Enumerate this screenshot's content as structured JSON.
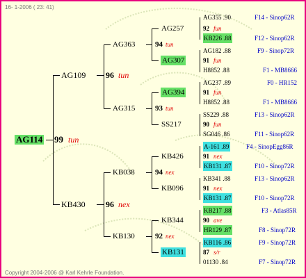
{
  "header": {
    "date_text": "16- 1-2006 ( 23: 41)"
  },
  "footer": {
    "copyright": "Copyright 2004-2006 @ Karl Kehrle Foundation."
  },
  "colors": {
    "border": "#e8007f",
    "background": "#ffffe1",
    "highlight_green": "#66e066",
    "highlight_cyan": "#3fe0e0",
    "score": "#000000",
    "quality_red": "#e00000",
    "ref_blue": "#0000c8"
  },
  "root": {
    "name": "AG114",
    "score": "99",
    "quality": "tun"
  },
  "gen1": [
    {
      "name": "AG109",
      "score": "96",
      "quality": "tun"
    },
    {
      "name": "KB430",
      "score": "96",
      "quality": "nex"
    }
  ],
  "gen2": [
    {
      "name": "AG363",
      "score": "94",
      "quality": "tun"
    },
    {
      "name": "AG315",
      "score": "93",
      "quality": "tun"
    },
    {
      "name": "KB038",
      "score": "94",
      "quality": "nex"
    },
    {
      "name": "KB130",
      "score": "92",
      "quality": "nex"
    }
  ],
  "gen3": [
    {
      "name": "AG257"
    },
    {
      "name": "AG307"
    },
    {
      "name": "AG394"
    },
    {
      "name": "SS217"
    },
    {
      "name": "KB426"
    },
    {
      "name": "KB096"
    },
    {
      "name": "KB344"
    },
    {
      "name": "KB131"
    }
  ],
  "gen4": [
    {
      "name": "AG355 .90",
      "score": "",
      "quality": "",
      "ref": "F14 - Sinop62R"
    },
    {
      "name": "",
      "score": "92",
      "quality": "fun",
      "ref": ""
    },
    {
      "name": "KB226 .88",
      "score": "",
      "quality": "",
      "ref": "F12 - Sinop62R"
    },
    {
      "name": "AG182 .88",
      "score": "",
      "quality": "",
      "ref": "F9 - Sinop72R"
    },
    {
      "name": "",
      "score": "91",
      "quality": "fun",
      "ref": ""
    },
    {
      "name": "H8852 .88",
      "score": "",
      "quality": "",
      "ref": "F1 - MB8666"
    },
    {
      "name": "AG237 .89",
      "score": "",
      "quality": "",
      "ref": "F0 - HR152"
    },
    {
      "name": "",
      "score": "91",
      "quality": "fun",
      "ref": ""
    },
    {
      "name": "H8852 .88",
      "score": "",
      "quality": "",
      "ref": "F1 - MB8666"
    },
    {
      "name": "SS229 .88",
      "score": "",
      "quality": "",
      "ref": "F13 - Sinop62R"
    },
    {
      "name": "",
      "score": "90",
      "quality": "fun",
      "ref": ""
    },
    {
      "name": "SG046 .86",
      "score": "",
      "quality": "",
      "ref": "F11 - Sinop62R"
    },
    {
      "name": "A-161 .89",
      "score": "",
      "quality": "",
      "ref": "F4 - SinopEgg86R"
    },
    {
      "name": "",
      "score": "91",
      "quality": "nex",
      "ref": ""
    },
    {
      "name": "KB131 .87",
      "score": "",
      "quality": "",
      "ref": "F10 - Sinop72R"
    },
    {
      "name": "KB341 .88",
      "score": "",
      "quality": "",
      "ref": "F13 - Sinop62R"
    },
    {
      "name": "",
      "score": "91",
      "quality": "nex",
      "ref": ""
    },
    {
      "name": "KB131 .87",
      "score": "",
      "quality": "",
      "ref": "F10 - Sinop72R"
    },
    {
      "name": "KB217 .88",
      "score": "",
      "quality": "",
      "ref": "F3 - Atlas85R"
    },
    {
      "name": "",
      "score": "90",
      "quality": "ave",
      "ref": ""
    },
    {
      "name": "HR129 .87",
      "score": "",
      "quality": "",
      "ref": "F8 - Sinop72R"
    },
    {
      "name": "KB116 .86",
      "score": "",
      "quality": "",
      "ref": "F9 - Sinop72R"
    },
    {
      "name": "",
      "score": "87",
      "quality": "s/r",
      "ref": ""
    },
    {
      "name": "01130 .84",
      "score": "",
      "quality": "",
      "ref": "F7 - Sinop72R"
    }
  ]
}
